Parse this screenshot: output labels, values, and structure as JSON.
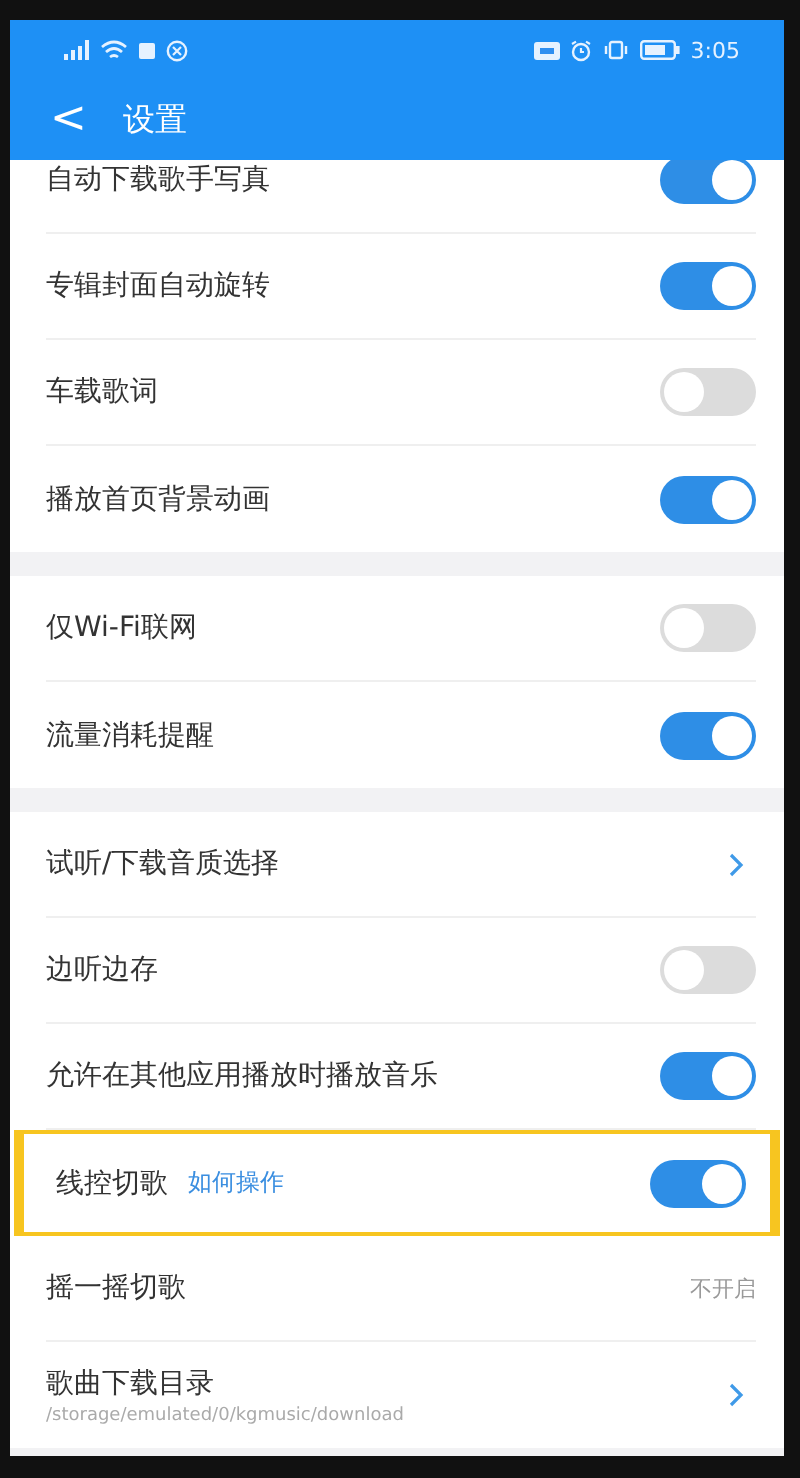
{
  "status_bar": {
    "time": "3:05"
  },
  "header": {
    "back": "<",
    "title": "设置"
  },
  "sections": [
    {
      "rows": [
        {
          "kind": "toggle",
          "label": "自动下载歌手写真",
          "on": true,
          "highlighted": false
        },
        {
          "kind": "toggle",
          "label": "专辑封面自动旋转",
          "on": true,
          "highlighted": false
        },
        {
          "kind": "toggle",
          "label": "车载歌词",
          "on": false,
          "highlighted": false
        },
        {
          "kind": "toggle",
          "label": "播放首页背景动画",
          "on": true,
          "highlighted": false
        }
      ]
    },
    {
      "rows": [
        {
          "kind": "toggle",
          "label": "仅Wi-Fi联网",
          "on": false,
          "highlighted": false
        },
        {
          "kind": "toggle",
          "label": "流量消耗提醒",
          "on": true,
          "highlighted": false
        }
      ]
    },
    {
      "rows": [
        {
          "kind": "link",
          "label": "试听/下载音质选择",
          "highlighted": false
        },
        {
          "kind": "toggle",
          "label": "边听边存",
          "on": false,
          "highlighted": false
        },
        {
          "kind": "toggle",
          "label": "允许在其他应用播放时播放音乐",
          "on": true,
          "highlighted": false
        },
        {
          "kind": "toggle",
          "label": "线控切歌",
          "help": "如何操作",
          "on": true,
          "highlighted": true
        },
        {
          "kind": "value",
          "label": "摇一摇切歌",
          "value": "不开启",
          "highlighted": false
        },
        {
          "kind": "link",
          "label": "歌曲下载目录",
          "subtitle": "/storage/emulated/0/kgmusic/download",
          "highlighted": false
        }
      ]
    }
  ]
}
